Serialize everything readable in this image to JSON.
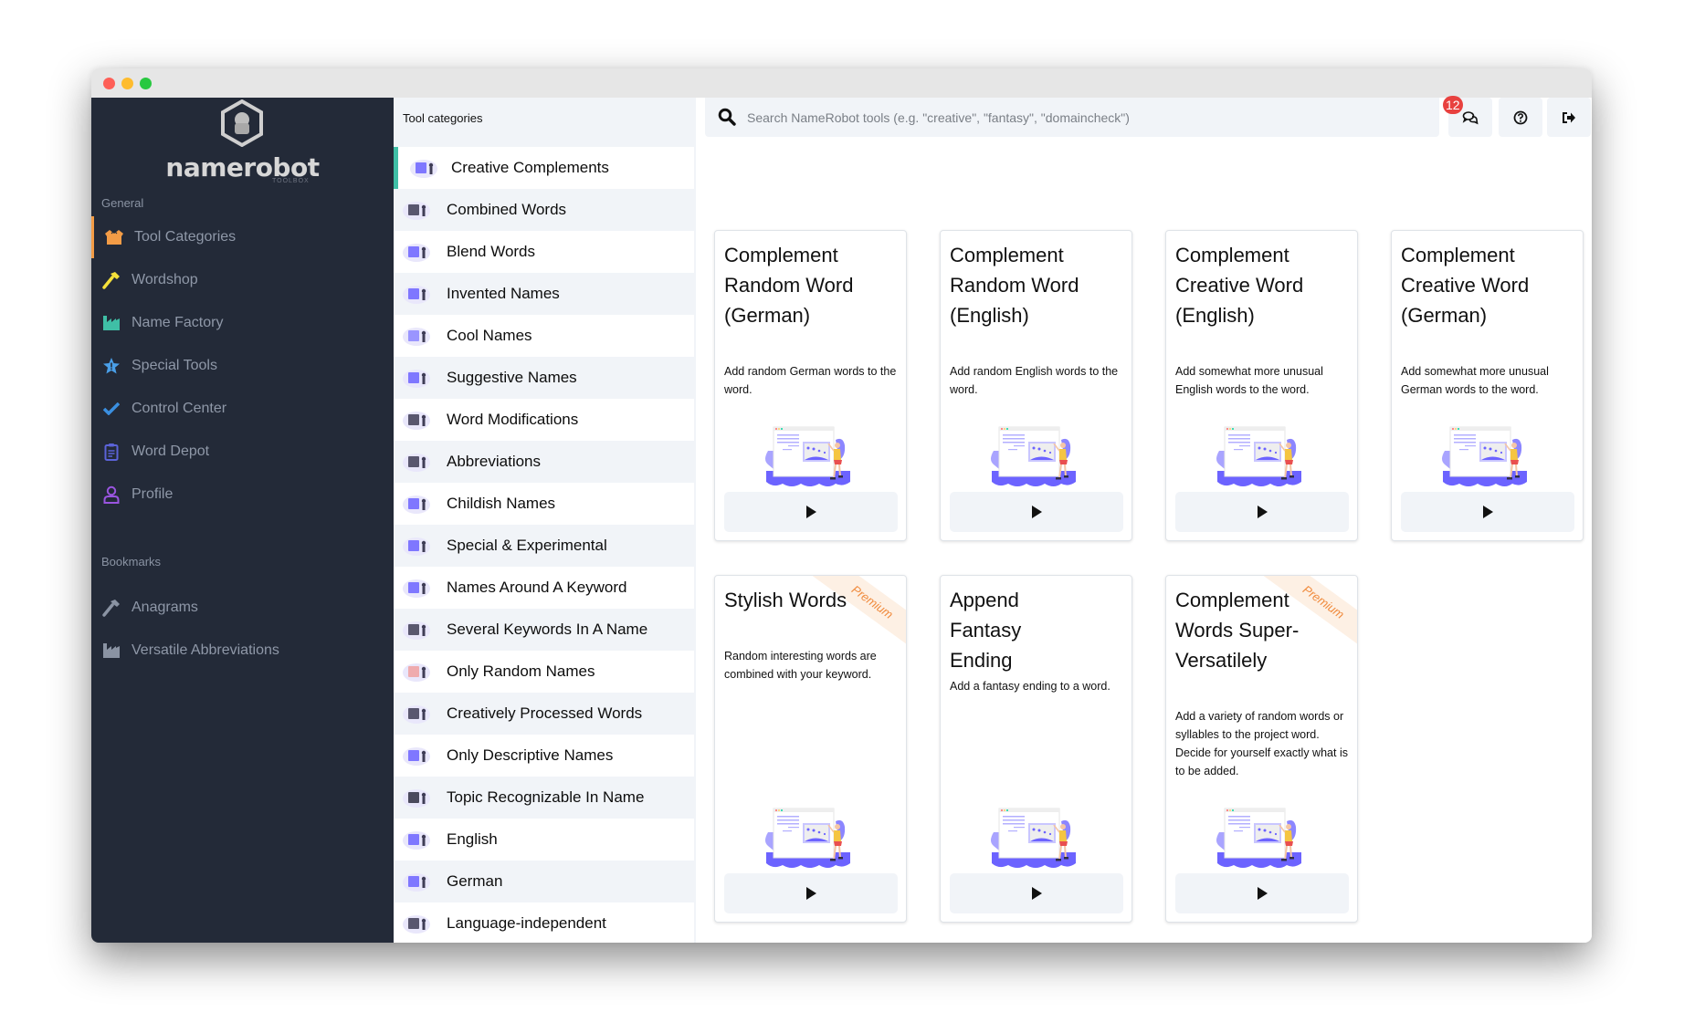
{
  "window": {
    "controls": [
      "close",
      "minimize",
      "maximize"
    ]
  },
  "sidebar": {
    "logo_text": "namerobot",
    "logo_subtext": "TOOLBOX",
    "general_label": "General",
    "items": [
      {
        "label": "Tool Categories",
        "icon": "box-open-icon",
        "color": "#f39c46",
        "active": true
      },
      {
        "label": "Wordshop",
        "icon": "hammer-icon",
        "color": "#f5e13a",
        "active": false
      },
      {
        "label": "Name Factory",
        "icon": "industry-icon",
        "color": "#3fbfa6",
        "active": false
      },
      {
        "label": "Special Tools",
        "icon": "star-exclamation-icon",
        "color": "#4a9fe8",
        "active": false
      },
      {
        "label": "Control Center",
        "icon": "check-icon",
        "color": "#3a8fe0",
        "active": false
      },
      {
        "label": "Word Depot",
        "icon": "clipboard-list-icon",
        "color": "#5b63d8",
        "active": false
      },
      {
        "label": "Profile",
        "icon": "user-icon",
        "color": "#9a55e0",
        "active": false
      }
    ],
    "bookmarks_label": "Bookmarks",
    "bookmarks": [
      {
        "label": "Anagrams",
        "icon": "hammer-icon",
        "color": "#8a93a3"
      },
      {
        "label": "Versatile Abbreviations",
        "icon": "industry-icon",
        "color": "#8a93a3"
      }
    ]
  },
  "categories": {
    "header": "Tool categories",
    "items": [
      "Creative Complements",
      "Combined Words",
      "Blend Words",
      "Invented Names",
      "Cool Names",
      "Suggestive Names",
      "Word Modifications",
      "Abbreviations",
      "Childish Names",
      "Special & Experimental",
      "Names Around A Keyword",
      "Several Keywords In A Name",
      "Only Random Names",
      "Creatively Processed Words",
      "Only Descriptive Names",
      "Topic Recognizable In Name",
      "English",
      "German",
      "Language-independent"
    ],
    "active_index": 0
  },
  "topbar": {
    "search_placeholder": "Search NameRobot tools (e.g. \"creative\", \"fantasy\", \"domaincheck\")",
    "search_value": "",
    "messages_badge": "12",
    "buttons": [
      "chat-icon",
      "help-icon",
      "logout-icon"
    ]
  },
  "cards": [
    {
      "title": "Complement Random Word (German)",
      "description": "Add random German words to the word.",
      "premium": false
    },
    {
      "title": "Complement Random Word (English)",
      "description": "Add random English words to the word.",
      "premium": false
    },
    {
      "title": "Complement Creative Word (English)",
      "description": "Add somewhat more unusual English words to the word.",
      "premium": false
    },
    {
      "title": "Complement Creative Word (German)",
      "description": "Add somewhat more unusual German words to the word.",
      "premium": false
    },
    {
      "title": "Stylish Words",
      "description": "Random interesting words are combined with your keyword.",
      "premium": true
    },
    {
      "title": "Append Fantasy Ending",
      "description": "Add a fantasy ending to a word.",
      "premium": false
    },
    {
      "title": "Complement Words Super-Versatilely",
      "description": "Add a variety of random words or syllables to the project word. Decide for yourself exactly what is to be added.",
      "premium": true
    }
  ],
  "premium_label": "Premium",
  "colors": {
    "sidebar_bg": "#232a38",
    "active_accent": "#f39c46",
    "category_accent": "#3fbfa6",
    "badge": "#e8413f",
    "illustration": "#6c63ff"
  }
}
